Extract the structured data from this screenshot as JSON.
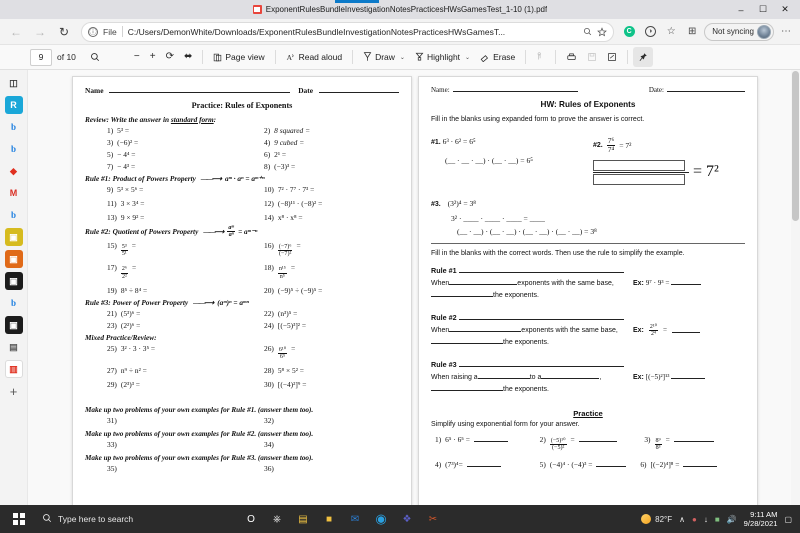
{
  "browser": {
    "tab": {
      "title": "ExponentRulesBundleInvestigationNotesPracticesHWsGamesTest_1-10 (1).pdf",
      "favicon": "pdf-icon"
    },
    "window_controls": {
      "minimize": "–",
      "maximize": "☐",
      "close": "✕"
    },
    "nav": {
      "back": "←",
      "forward": "→",
      "reload": "↻"
    },
    "omnibox": {
      "info_icon": "ⓘ",
      "scheme_label": "File",
      "url": "C:/Users/DemonWhite/Downloads/ExponentRulesBundleInvestigationNotesPracticesHWsGamesT...",
      "search_icon": "search-icon",
      "favorite_icon": "star-icon"
    },
    "toolbar_right": {
      "ext1": "C",
      "ext2": "◑",
      "collections": "☆",
      "split": "⊞",
      "sync_label": "Not syncing",
      "settings": "⋯"
    }
  },
  "pdf_toolbar": {
    "page_current": "9",
    "page_total": "of 10",
    "search_icon": "search-icon",
    "zoom_out": "−",
    "zoom_in": "+",
    "rotate": "⟳",
    "fit": "⬌",
    "page_view_label": "Page view",
    "page_view_icon": "page-view-icon",
    "read_aloud_label": "Read aloud",
    "read_aloud_icon": "A",
    "draw_label": "Draw",
    "draw_icon": "pen-icon",
    "highlight_label": "Highlight",
    "highlight_icon": "highlighter-icon",
    "erase_label": "Erase",
    "erase_icon": "eraser-icon",
    "hand_icon": "hand-icon",
    "print_icon": "printer-icon",
    "save_icon": "save-icon",
    "notes_icon": "notes-icon",
    "pin_icon": "pin-icon",
    "caret": "⌄"
  },
  "sidebar": {
    "items": [
      {
        "name": "sidebar-item-tab-manager",
        "glyph": "◫",
        "bg": "#f3f3f3",
        "fg": "#3c3c3c"
      },
      {
        "name": "sidebar-item-r-app",
        "glyph": "R",
        "bg": "#1aa7d8",
        "fg": "#ffffff"
      },
      {
        "name": "sidebar-item-bing-1",
        "glyph": "b",
        "bg": "#f3f3f3",
        "fg": "#1e7fe0"
      },
      {
        "name": "sidebar-item-bing-2",
        "glyph": "b",
        "bg": "#f3f3f3",
        "fg": "#1e7fe0"
      },
      {
        "name": "sidebar-item-red-app",
        "glyph": "◆",
        "bg": "#f3f3f3",
        "fg": "#e03020"
      },
      {
        "name": "sidebar-item-gmail",
        "glyph": "M",
        "bg": "#f3f3f3",
        "fg": "#d93025"
      },
      {
        "name": "sidebar-item-bing-3",
        "glyph": "b",
        "bg": "#f3f3f3",
        "fg": "#1e7fe0"
      },
      {
        "name": "sidebar-item-yellow-app",
        "glyph": "▣",
        "bg": "#d6bb1f",
        "fg": "#ffffff"
      },
      {
        "name": "sidebar-item-orange-app",
        "glyph": "▣",
        "bg": "#e06a18",
        "fg": "#ffffff"
      },
      {
        "name": "sidebar-item-dark-app-1",
        "glyph": "▣",
        "bg": "#1c1c1c",
        "fg": "#ffffff"
      },
      {
        "name": "sidebar-item-bing-4",
        "glyph": "b",
        "bg": "#f3f3f3",
        "fg": "#1e7fe0"
      },
      {
        "name": "sidebar-item-dark-app-2",
        "glyph": "▣",
        "bg": "#1c1c1c",
        "fg": "#ffffff"
      },
      {
        "name": "sidebar-item-archive",
        "glyph": "▤",
        "bg": "#f3f3f3",
        "fg": "#5c5c5c"
      },
      {
        "name": "sidebar-item-pdf-active",
        "glyph": "▥",
        "bg": "#ffffff",
        "fg": "#e03020"
      },
      {
        "name": "sidebar-item-add",
        "glyph": "+",
        "bg": "#e8e8e8",
        "fg": "#5a5a5a"
      }
    ]
  },
  "left_page": {
    "name_label": "Name",
    "date_label": "Date",
    "title": "Practice: Rules of Exponents",
    "review_heading_pre": "Review:  Write the answer in ",
    "review_heading_underlined": "standard form",
    "review_heading_post": ":",
    "review_items": [
      {
        "n": "1)",
        "e": "5³ ="
      },
      {
        "n": "2)",
        "e": "8 squared =",
        "italic": true
      },
      {
        "n": "3)",
        "e": "(−6)² ="
      },
      {
        "n": "4)",
        "e": "9 cubed =",
        "italic": true
      },
      {
        "n": "5)",
        "e": "− 4⁴ ="
      },
      {
        "n": "6)",
        "e": "2¹ ="
      },
      {
        "n": "7)",
        "e": "− 4³ ="
      },
      {
        "n": "8)",
        "e": "(−3)³ ="
      }
    ],
    "rule1_label": "Rule #1:  Product of Powers Property",
    "rule1_formula": "aᵐ · aⁿ =  aᵐ⁺ⁿ",
    "rule1_items": [
      {
        "n": "9)",
        "e": "5³ × 5⁶ ="
      },
      {
        "n": "10)",
        "e": "7² · 7⁷ · 7³ ="
      },
      {
        "n": "11)",
        "e": "3 × 3⁴ ="
      },
      {
        "n": "12)",
        "e": "(−8)¹¹ · (−8)² ="
      },
      {
        "n": "13)",
        "e": "9 × 9² ="
      },
      {
        "n": "14)",
        "e": "x⁸ · x⁸ ="
      }
    ],
    "rule2_label": "Rule #2:  Quotient of Powers Property",
    "rule2_formula_num": "aᵐ",
    "rule2_formula_den": "aⁿ",
    "rule2_formula_rhs": "= aᵐ⁻ⁿ",
    "rule2_items": [
      {
        "n": "15)",
        "num": "5³",
        "den": "5¹"
      },
      {
        "n": "16)",
        "num": "(−7)⁶",
        "den": "(−7)²"
      },
      {
        "n": "17)",
        "num": "2⁶",
        "den": "2²"
      },
      {
        "n": "18)",
        "num": "n¹⁵",
        "den": "n⁵"
      },
      {
        "n": "19)",
        "e": "8⁵ ÷ 8⁴ ="
      },
      {
        "n": "20)",
        "e": "(−9)⁵ ÷ (−9)⁵ ="
      }
    ],
    "rule3_label": "Rule #3:  Power of Power Property",
    "rule3_formula": "(aᵐ)ⁿ = aᵐⁿ",
    "rule3_items": [
      {
        "n": "21)",
        "e": "(5³)⁶ ="
      },
      {
        "n": "22)",
        "e": "(n³)⁵ ="
      },
      {
        "n": "23)",
        "e": "(2²)⁶ ="
      },
      {
        "n": "24)",
        "e": "[(−5)³]² ="
      }
    ],
    "mixed_heading": "Mixed Practice/Review:",
    "mixed_items": [
      {
        "n": "25)",
        "e": "3² · 3 · 3⁵ ="
      },
      {
        "n": "26)",
        "num": "6¹⁰",
        "den": "6⁵"
      },
      {
        "n": "27)",
        "e": "n⁹ ÷ n² ="
      },
      {
        "n": "28)",
        "e": "5⁸ × 5² ="
      },
      {
        "n": "29)",
        "e": "(2³)³ ="
      },
      {
        "n": "30)",
        "e": "[(−4)²]⁹ ="
      }
    ],
    "makeup": [
      {
        "prompt": "Make up two problems of your own examples for Rule #1. (answer them too).",
        "a": "31)",
        "b": "32)"
      },
      {
        "prompt": "Make up two problems of your own examples for Rule #2. (answer them too).",
        "a": "33)",
        "b": "34)"
      },
      {
        "prompt": "Make up two problems of your own examples for Rule #3. (answer them too).",
        "a": "35)",
        "b": "36)"
      }
    ]
  },
  "right_page": {
    "name_label": "Name:",
    "date_label": "Date:",
    "title": "HW: Rules of Exponents",
    "intro": "Fill in the blanks using expanded form to prove the answer is correct.",
    "q1": {
      "num": "#1.",
      "statement": "6³ · 6² = 6⁵",
      "work": "(__ · __ · __) · (__ · __) = 6⁵"
    },
    "q2": {
      "num": "#2.",
      "num_frac_top": "7⁶",
      "num_frac_bot": "7⁴",
      "equals": "= 7²",
      "box_equals": "= 7²"
    },
    "q3": {
      "num": "#3.",
      "statement": "(3²)⁴ = 3⁸",
      "work1": "3² · ____ · ____ · ____ = ____",
      "work2": "(__ · __) · (__ · __) · (__ · __) · (__ · __) = 3⁸"
    },
    "rules_intro": "Fill in the blanks with the correct words.  Then use the rule to simplify the example.",
    "rules": [
      {
        "label": "Rule #1",
        "line1_pre": "When ",
        "line1_post": "exponents with the same base,",
        "line2_post": " the exponents.",
        "ex_label": "Ex:",
        "ex_expr": "9⁷ · 9³ = ",
        "ex_frac": false
      },
      {
        "label": "Rule #2",
        "line1_pre": "When ",
        "line1_post": " exponents with the same base,",
        "line2_post": " the exponents.",
        "ex_label": "Ex:",
        "ex_expr": "",
        "ex_frac": true,
        "ex_frac_num": "2¹⁰",
        "ex_frac_den": "2⁴",
        "ex_frac_eq": "="
      },
      {
        "label": "Rule #3",
        "line1_pre": "When raising a ",
        "line1_mid": " to a ",
        "line1_post": ",",
        "line2_post": " the exponents.",
        "ex_label": "Ex:",
        "ex_expr": "[(−5)²]¹³ ",
        "ex_frac": false
      }
    ],
    "practice_title": "Practice",
    "practice_intro": "Simplify using exponential form for your answer.",
    "practice_items": [
      {
        "n": "1)",
        "e": "6⁵ · 6⁵ ="
      },
      {
        "n": "2)",
        "num": "(−5)¹⁰",
        "den": "(−5)²",
        "e": ""
      },
      {
        "n": "3)",
        "num": "8⁹",
        "den": "8³",
        "e": ""
      },
      {
        "n": "4)",
        "e": "(7³)⁴="
      },
      {
        "n": "5)",
        "e": "(−4)⁴ · (−4)³ ="
      },
      {
        "n": "6)",
        "e": "[(−2)⁴]⁸  ="
      }
    ]
  },
  "taskbar": {
    "search_placeholder": "Type here to search",
    "search_icon": "search-icon",
    "start_icon": "windows-logo-icon",
    "icons": [
      {
        "name": "cortana-icon",
        "glyph": "O",
        "color": "#ffffff"
      },
      {
        "name": "task-view-icon",
        "glyph": "⌸",
        "color": "#e6e6e6"
      },
      {
        "name": "file-explorer-icon",
        "glyph": "▤",
        "color": "#f7c843"
      },
      {
        "name": "store-icon",
        "glyph": "■",
        "color": "#f0c040"
      },
      {
        "name": "mail-icon",
        "glyph": "✉",
        "color": "#2c7fd4"
      },
      {
        "name": "edge-icon",
        "glyph": "◕",
        "color": "#2aa0e0"
      },
      {
        "name": "teams-icon",
        "glyph": "❖",
        "color": "#5b5fc7"
      },
      {
        "name": "snip-tool-icon",
        "glyph": "✂",
        "color": "#d4572a"
      }
    ],
    "weather_temp": "82°F",
    "tray": [
      {
        "name": "tray-expand-icon",
        "glyph": "∧"
      },
      {
        "name": "tray-app-icon",
        "glyph": "●"
      },
      {
        "name": "tray-usb-icon",
        "glyph": "↓"
      },
      {
        "name": "tray-network-icon",
        "glyph": "■"
      },
      {
        "name": "tray-volume-icon",
        "glyph": "🔊"
      }
    ],
    "time": "9:11 AM",
    "date": "9/28/2021",
    "action_center_icon": "▢"
  }
}
